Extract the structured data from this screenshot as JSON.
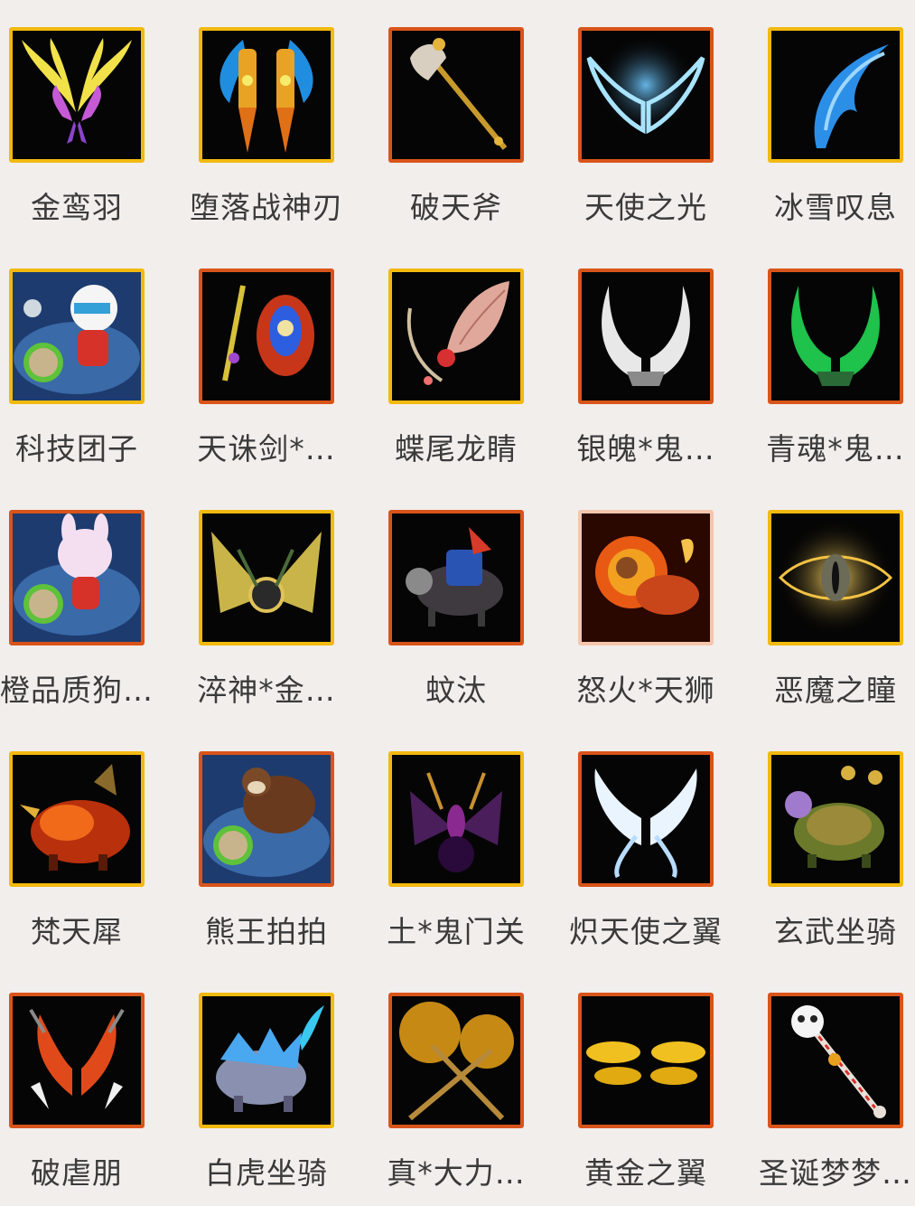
{
  "items": [
    {
      "name": "金鸾羽",
      "border": "gold",
      "icon": "golden-wings-icon"
    },
    {
      "name": "堕落战神刃",
      "border": "gold",
      "icon": "fallen-war-god-blades-icon"
    },
    {
      "name": "破天斧",
      "border": "orange",
      "icon": "sky-breaking-axe-icon"
    },
    {
      "name": "天使之光",
      "border": "orange",
      "icon": "angel-light-wings-icon"
    },
    {
      "name": "冰雪叹息",
      "border": "gold",
      "icon": "ice-sigh-wing-icon"
    },
    {
      "name": "科技团子",
      "border": "gold",
      "icon": "tech-dumpling-pet-icon"
    },
    {
      "name": "天诛剑*…",
      "border": "orange",
      "icon": "heaven-punish-sword-icon"
    },
    {
      "name": "蝶尾龙睛",
      "border": "gold",
      "icon": "butterfly-tail-bow-icon"
    },
    {
      "name": "银魄*鬼…",
      "border": "orange",
      "icon": "silver-soul-wings-icon"
    },
    {
      "name": "青魂*鬼…",
      "border": "orange",
      "icon": "green-soul-wings-icon"
    },
    {
      "name": "橙品质狗…",
      "border": "orange",
      "icon": "bunny-pet-egg-icon"
    },
    {
      "name": "淬神*金…",
      "border": "gold",
      "icon": "golden-fan-wings-icon"
    },
    {
      "name": "蚊汰",
      "border": "orange",
      "icon": "mosquito-mount-icon"
    },
    {
      "name": "怒火*天狮",
      "border": "peach",
      "icon": "fire-lion-mount-icon"
    },
    {
      "name": "恶魔之瞳",
      "border": "gold",
      "icon": "demon-eye-icon"
    },
    {
      "name": "梵天犀",
      "border": "gold",
      "icon": "fire-rhino-mount-icon"
    },
    {
      "name": "熊王拍拍",
      "border": "orange",
      "icon": "bear-king-pet-icon"
    },
    {
      "name": "土*鬼门关",
      "border": "gold",
      "icon": "ghost-gate-wings-icon"
    },
    {
      "name": "炽天使之翼",
      "border": "orange",
      "icon": "seraph-wings-icon"
    },
    {
      "name": "玄武坐骑",
      "border": "gold",
      "icon": "turtle-mount-icon"
    },
    {
      "name": "破虐朋",
      "border": "orange",
      "icon": "flame-claw-wings-icon"
    },
    {
      "name": "白虎坐骑",
      "border": "gold",
      "icon": "white-tiger-mount-icon"
    },
    {
      "name": "真*大力…",
      "border": "orange",
      "icon": "golden-hammers-icon"
    },
    {
      "name": "黄金之翼",
      "border": "orange",
      "icon": "golden-butterfly-wings-icon"
    },
    {
      "name": "圣诞梦梦…",
      "border": "orange",
      "icon": "christmas-staff-icon"
    }
  ],
  "colors": {
    "background": "#f2eeec",
    "border_gold": "#f2b90f",
    "border_orange": "#d9541a",
    "border_peach": "#f4c6ad",
    "label": "#3a3a3a"
  }
}
